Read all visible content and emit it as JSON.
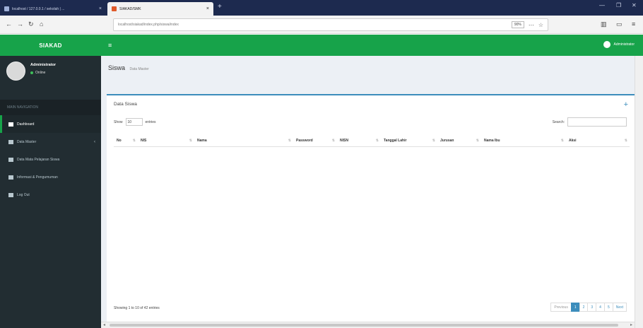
{
  "browser": {
    "tabs": [
      {
        "title": "localhost / 127.0.0.1 / sekolah | ..."
      },
      {
        "title": "SIAKAD/SMK"
      }
    ],
    "url": "localhost/siakad/index.php/siswa/index",
    "zoom": "90%"
  },
  "app": {
    "brand": "SIAKAD",
    "user_name": "Administrator",
    "user_status": "Online",
    "topbar_user": "Administrator"
  },
  "sidebar": {
    "header": "MAIN NAVIGATION",
    "items": [
      {
        "label": "Dashboard"
      },
      {
        "label": "Data Master"
      },
      {
        "label": "Data Mata Pelajaran Siswa"
      },
      {
        "label": "Informasi & Pengumuman"
      },
      {
        "label": "Log Out"
      }
    ]
  },
  "page": {
    "title": "Siswa",
    "subtitle": "Data Master"
  },
  "box": {
    "title": "Data Siswa",
    "show_label": "Show",
    "entries_value": "10",
    "entries_label": "entries",
    "search_label": "Search:"
  },
  "table": {
    "columns": [
      "No",
      "NIS",
      "Nama",
      "Password",
      "NISN",
      "Tanggal Lahir",
      "Jurusan",
      "Nama Ibu",
      "Aksi"
    ]
  },
  "footer": {
    "info": "Showing 1 to 10 of 42 entries",
    "pagination": [
      "Previous",
      "1",
      "2",
      "3",
      "4",
      "5",
      "Next"
    ]
  }
}
